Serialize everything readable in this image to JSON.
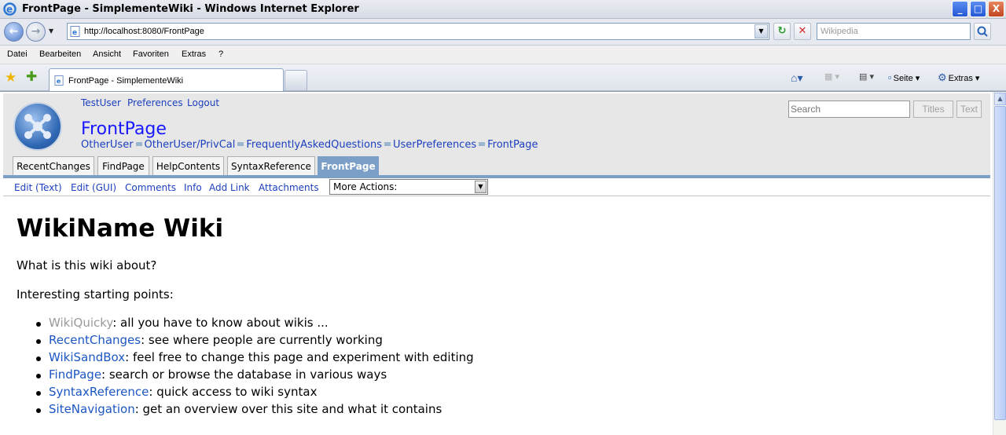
{
  "window": {
    "title": "FrontPage - SimplementeWiki - Windows Internet Explorer",
    "controls": {
      "minimize": "_",
      "maximize": "□",
      "close": "X"
    }
  },
  "addressbar": {
    "back": "←",
    "forward": "→",
    "url": "http://localhost:8080/FrontPage",
    "search_placeholder": "Wikipedia"
  },
  "menubar": {
    "items": [
      "Datei",
      "Bearbeiten",
      "Ansicht",
      "Favoriten",
      "Extras",
      "?"
    ]
  },
  "tabs": {
    "active": "FrontPage - SimplementeWiki",
    "commands": {
      "page": "Seite",
      "tools": "Extras"
    }
  },
  "wiki": {
    "usermenu": [
      "TestUser",
      "Preferences",
      "Logout"
    ],
    "page_title": "FrontPage",
    "trail": [
      "OtherUser",
      "OtherUser/PrivCal",
      "FrequentlyAskedQuestions",
      "UserPreferences",
      "FrontPage"
    ],
    "search_placeholder": "Search",
    "search_buttons": [
      "Titles",
      "Text"
    ],
    "navibar": [
      "RecentChanges",
      "FindPage",
      "HelpContents",
      "SyntaxReference",
      "FrontPage"
    ],
    "editbar": [
      "Edit (Text)",
      "Edit (GUI)",
      "Comments",
      "Info",
      "Add Link",
      "Attachments"
    ],
    "more_actions": "More Actions:"
  },
  "content": {
    "heading": "WikiName Wiki",
    "intro": "What is this wiki about?",
    "starting": "Interesting starting points:",
    "items": [
      {
        "link": "WikiQuicky",
        "text": ": all you have to know about wikis ..."
      },
      {
        "link": "RecentChanges",
        "text": ": see where people are currently working"
      },
      {
        "link": "WikiSandBox",
        "text": ": feel free to change this page and experiment with editing"
      },
      {
        "link": "FindPage",
        "text": ": search or browse the database in various ways"
      },
      {
        "link": "SyntaxReference",
        "text": ": quick access to wiki syntax"
      },
      {
        "link": "SiteNavigation",
        "text": ": get an overview over this site and what it contains"
      }
    ]
  },
  "colors": {
    "link": "#1c3fbf",
    "current_tab": "#7b9fc7",
    "nonexistent_link": "#9a9a9a"
  }
}
